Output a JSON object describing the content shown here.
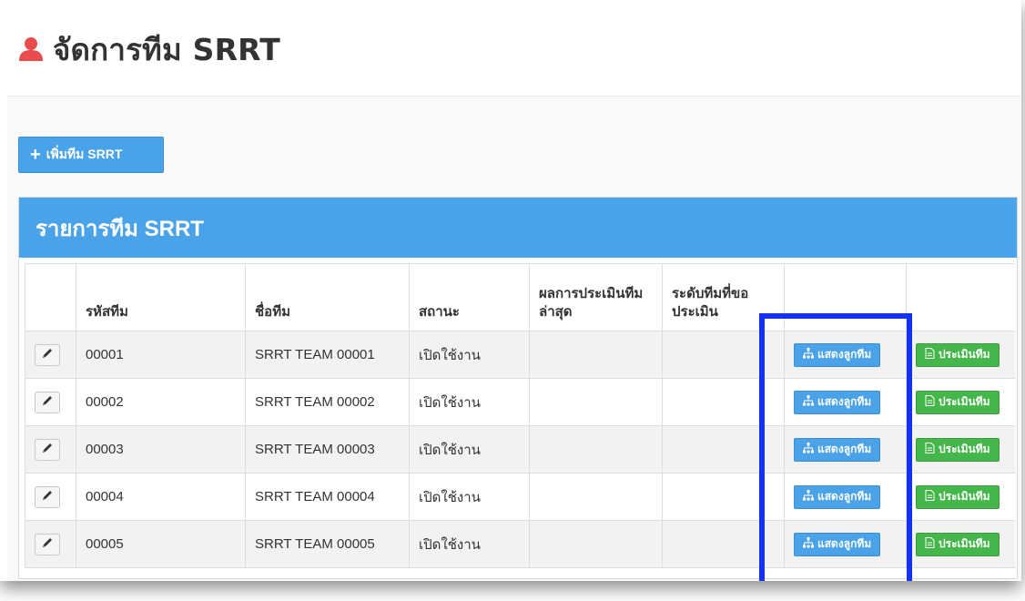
{
  "header": {
    "title": "จัดการทีม SRRT",
    "title_icon": "user-icon",
    "accent_color": "#e84c4c"
  },
  "toolbar": {
    "add_label": "เพิ่มทีม SRRT",
    "add_icon": "plus-icon"
  },
  "panel": {
    "heading": "รายการทีม SRRT",
    "heading_color": "#4aa3e8"
  },
  "table": {
    "columns": [
      "",
      "รหัสทีม",
      "ชื่อทีม",
      "สถานะ",
      "ผลการประเมินทีมล่าสุด",
      "ระดับทีมที่ขอประเมิน",
      "",
      ""
    ],
    "rows": [
      {
        "id": "00001",
        "name": "SRRT TEAM 00001",
        "status": "เปิดใช้งาน",
        "last_result": "",
        "level": ""
      },
      {
        "id": "00002",
        "name": "SRRT TEAM 00002",
        "status": "เปิดใช้งาน",
        "last_result": "",
        "level": ""
      },
      {
        "id": "00003",
        "name": "SRRT TEAM 00003",
        "status": "เปิดใช้งาน",
        "last_result": "",
        "level": ""
      },
      {
        "id": "00004",
        "name": "SRRT TEAM 00004",
        "status": "เปิดใช้งาน",
        "last_result": "",
        "level": ""
      },
      {
        "id": "00005",
        "name": "SRRT TEAM 00005",
        "status": "เปิดใช้งาน",
        "last_result": "",
        "level": ""
      }
    ],
    "members_label": "แสดงลูกทีม",
    "members_icon": "sitemap-icon",
    "assess_label": "ประเมินทีม",
    "assess_icon": "document-icon",
    "edit_icon": "pencil-icon",
    "members_color": "#4aa3e8",
    "assess_color": "#45b649"
  },
  "annotation": {
    "highlight_color": "#1433ee"
  }
}
